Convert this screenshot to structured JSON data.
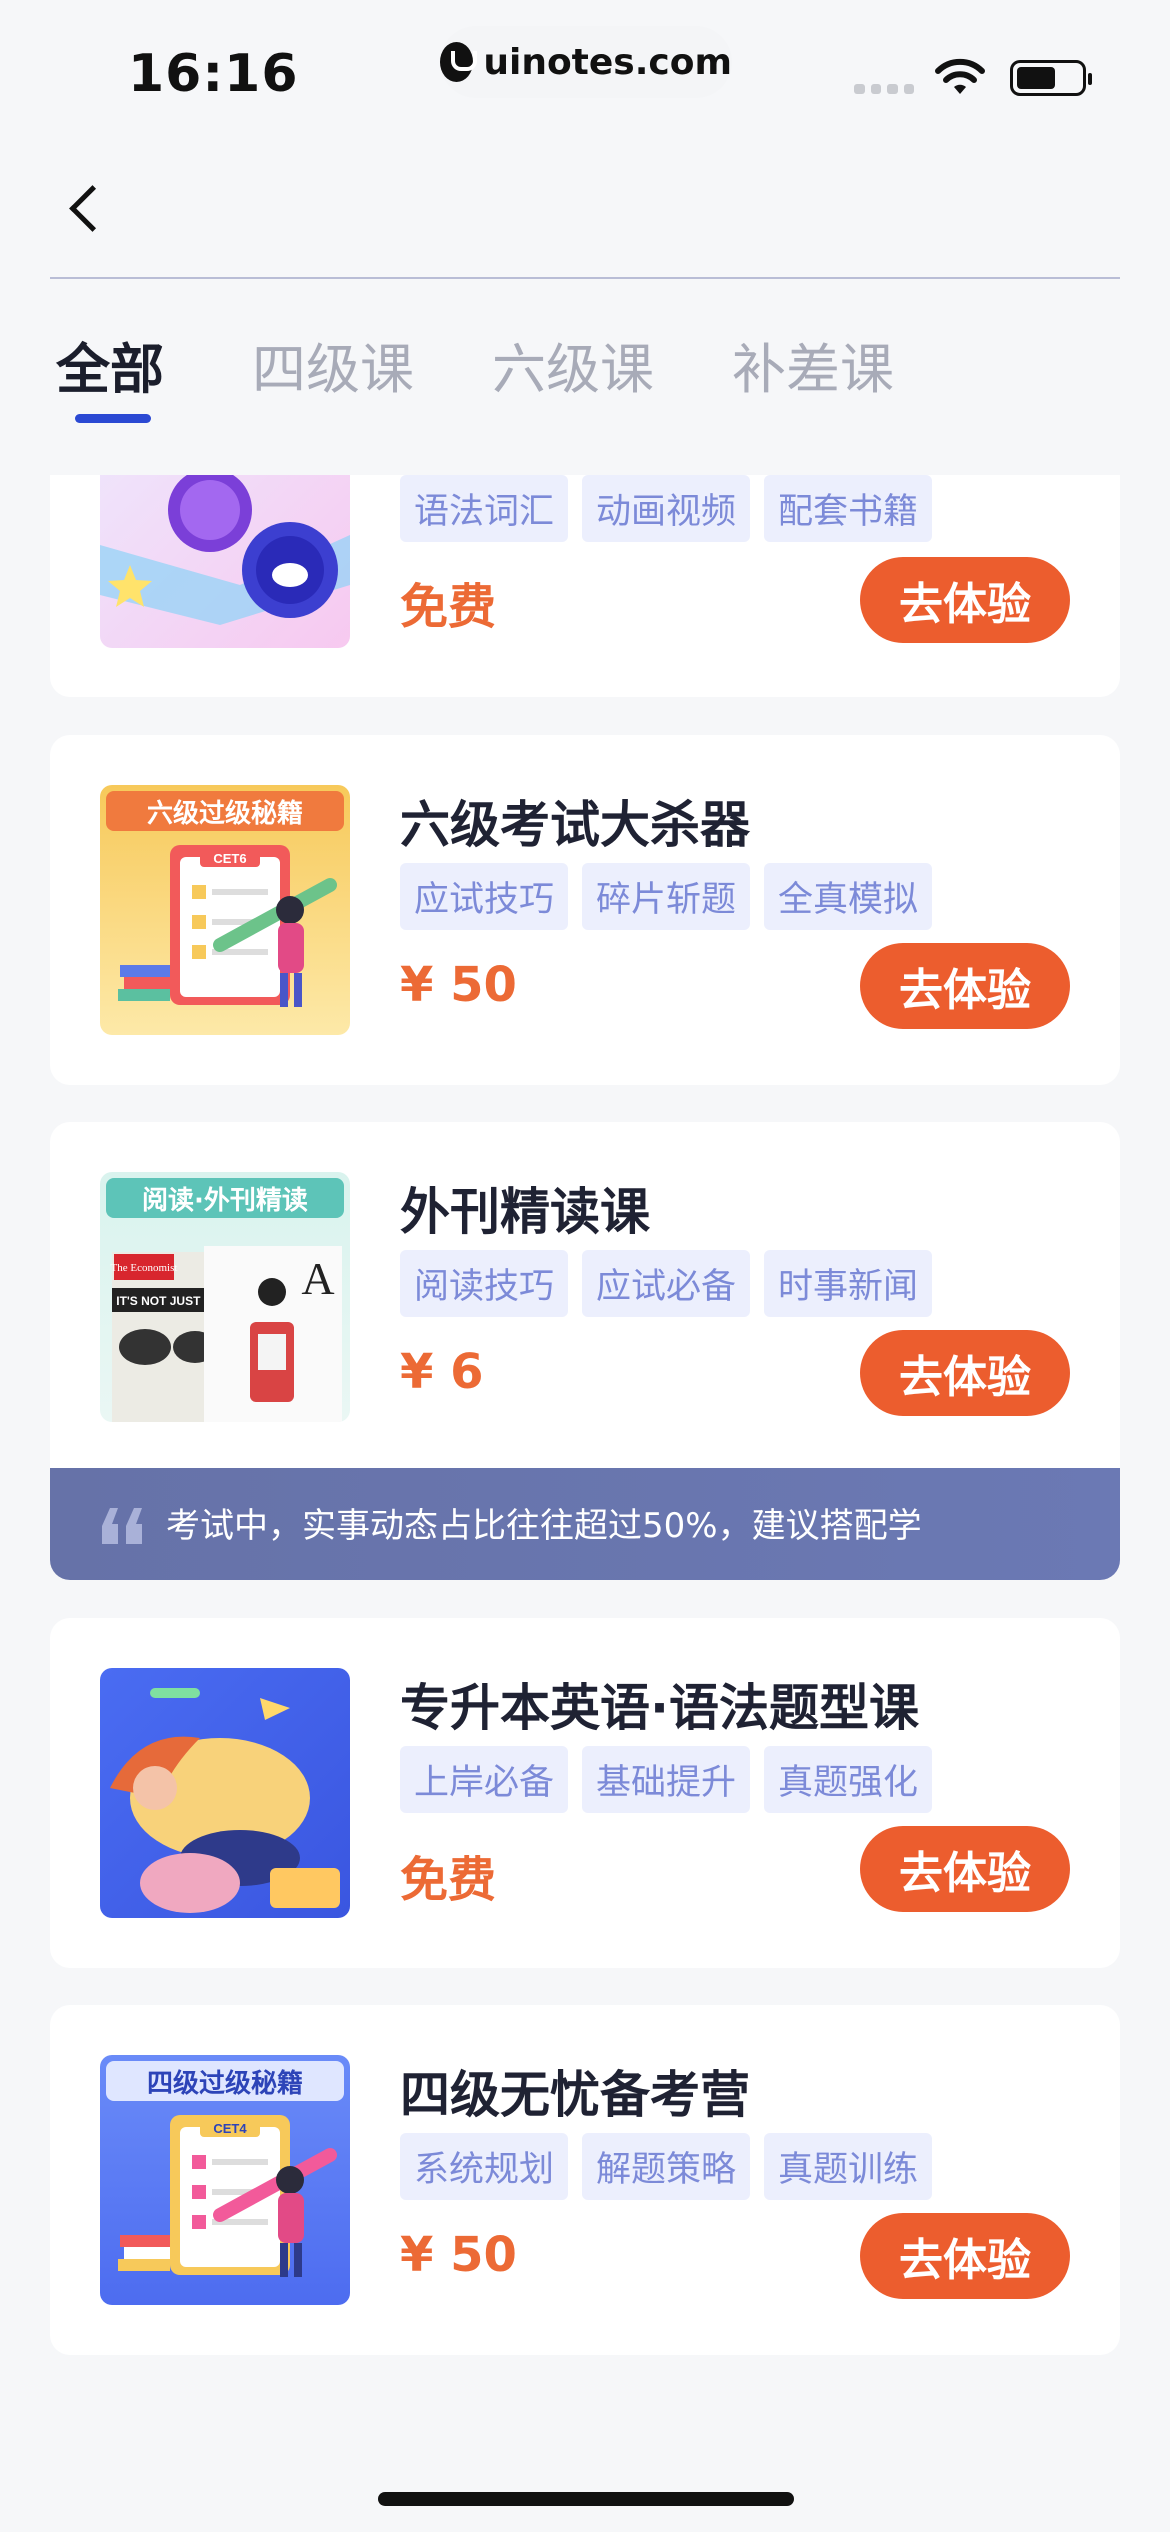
{
  "status_bar": {
    "time": "16:16",
    "url": "uinotes.com"
  },
  "tabs": [
    {
      "label": "全部",
      "active": true
    },
    {
      "label": "四级课",
      "active": false
    },
    {
      "label": "六级课",
      "active": false
    },
    {
      "label": "补差课",
      "active": false
    }
  ],
  "courses": [
    {
      "title": "",
      "tags": [
        "语法词汇",
        "动画视频",
        "配套书籍"
      ],
      "price": "免费",
      "button": "去体验",
      "thumb_ribbon": ""
    },
    {
      "title": "六级考试大杀器",
      "tags": [
        "应试技巧",
        "碎片斩题",
        "全真模拟"
      ],
      "price": "¥ 50",
      "button": "去体验",
      "thumb_ribbon": "六级过级秘籍",
      "thumb_label": "CET6"
    },
    {
      "title": "外刊精读课",
      "tags": [
        "阅读技巧",
        "应试必备",
        "时事新闻"
      ],
      "price": "¥ 6",
      "button": "去体验",
      "thumb_ribbon": "阅读·外刊精读",
      "thumb_texts": [
        "The Economist",
        "IT'S NOT JUST IN",
        "A"
      ]
    },
    {
      "title": "专升本英语·语法题型课",
      "tags": [
        "上岸必备",
        "基础提升",
        "真题强化"
      ],
      "price": "免费",
      "button": "去体验",
      "thumb_ribbon": ""
    },
    {
      "title": "四级无忧备考营",
      "tags": [
        "系统规划",
        "解题策略",
        "真题训练"
      ],
      "price": "¥ 50",
      "button": "去体验",
      "thumb_ribbon": "四级过级秘籍",
      "thumb_label": "CET4"
    }
  ],
  "banner": {
    "text": "考试中，实事动态占比往往超过50%，建议搭配学"
  },
  "colors": {
    "accent": "#ec5d2e",
    "price": "#ec6a35",
    "tab_indicator": "#2b49d3",
    "tag_bg": "#eceffd",
    "tag_text": "#7c8ad8",
    "banner": "#6672a8"
  }
}
